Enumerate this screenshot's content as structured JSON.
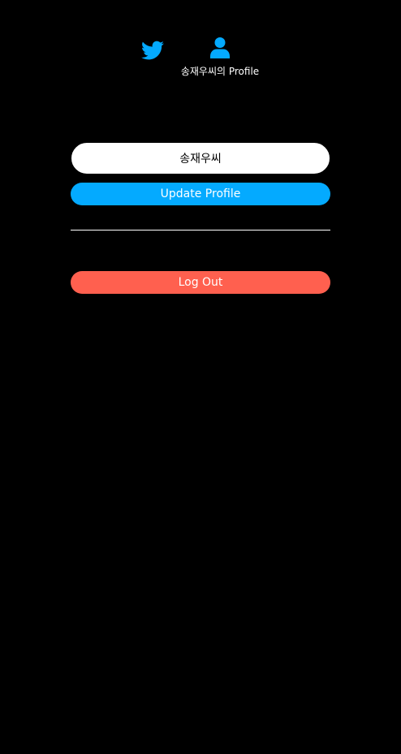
{
  "nav": {
    "home_icon": "twitter-bird-icon",
    "profile_icon": "user-icon",
    "profile_label": "송재우씨의 Profile"
  },
  "profile_form": {
    "display_name_value": "송재우씨",
    "update_button_label": "Update Profile"
  },
  "logout": {
    "label": "Log Out"
  },
  "colors": {
    "background": "#000000",
    "accent": "#04aaff",
    "danger": "#ff604f",
    "input_bg": "#ffffff",
    "text": "#ffffff"
  }
}
